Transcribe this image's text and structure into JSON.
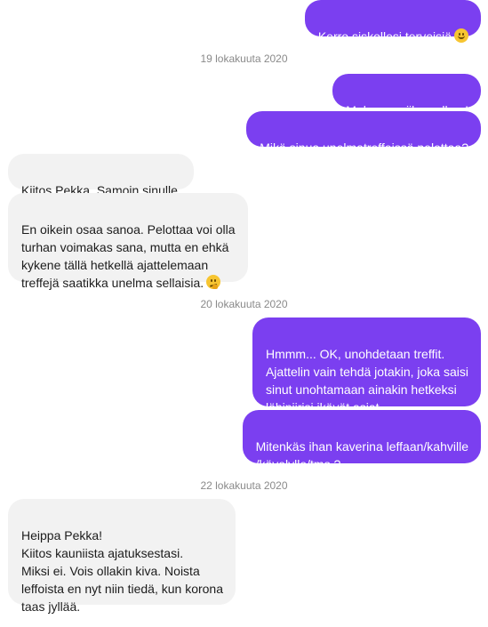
{
  "conversation": {
    "messages": [
      {
        "text": "Kerro siskollesi terveisiä",
        "emoji": "smiling-face-icon"
      },
      {
        "date": "19 lokakuuta 2020"
      },
      {
        "text": "Mukavaa viikon alkua!"
      },
      {
        "text": "Mikä sinua unelmatreffeissä pelottaa?"
      },
      {
        "text": "Kiitos Pekka. Samoin sinulle."
      },
      {
        "text": "En oikein osaa sanoa. Pelottaa voi olla\nturhan voimakas sana, mutta en ehkä\nkykene tällä hetkellä ajattelemaan\ntreffejä saatikka unelma sellaisia.",
        "emoji": "thinking-face-icon"
      },
      {
        "date": "20 lokakuuta 2020"
      },
      {
        "text": "Hmmm... OK, unohdetaan treffit.\nAjattelin vain tehdä jotakin, joka saisi\nsinut unohtamaan ainakin hetkeksi\nlähipiirisi ikävät asiat..."
      },
      {
        "text": "Mitenkäs ihan kaverina leffaan/kahville\n/kävelylle/tms.?"
      },
      {
        "date": "22 lokakuuta 2020"
      },
      {
        "text": "Heippa Pekka!\nKiitos kauniista ajatuksestasi.\nMiksi ei. Vois ollakin kiva. Noista\nleffoista en nyt niin tiedä, kun korona\ntaas jyllää."
      }
    ]
  },
  "colors": {
    "outgoing_bubble": "#7b3ff0",
    "incoming_bubble": "#f2f2f2",
    "date_text": "#8a8a8a"
  }
}
